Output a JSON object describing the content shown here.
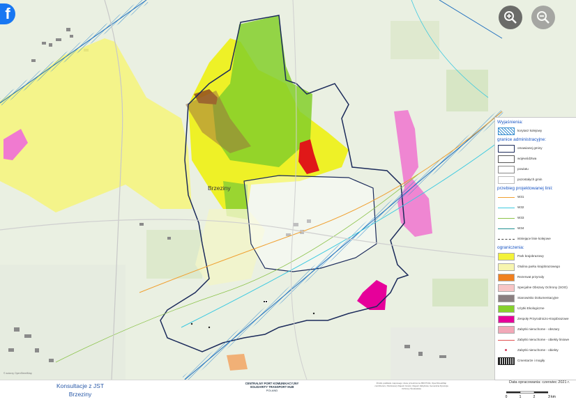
{
  "map": {
    "town_label": "Brzeziny",
    "attribution": "© autorzy OpenStreetMap"
  },
  "controls": {
    "facebook_glyph": "f",
    "zoom_in": "zoom-in",
    "zoom_out": "zoom-out"
  },
  "legend": {
    "heading": "Wyjaśnienia:",
    "items": [
      {
        "label": "korytarz kolejowy",
        "kind": "hatch",
        "color": "#3a8fd0"
      },
      {
        "label": "granice administracyjne:",
        "kind": "heading"
      },
      {
        "label": "omawianej gminy",
        "kind": "box",
        "color": "#1b2a5a"
      },
      {
        "label": "województwa",
        "kind": "box",
        "color": "#555555"
      },
      {
        "label": "powiatu",
        "kind": "box",
        "color": "#888888"
      },
      {
        "label": "pozostałych gmin",
        "kind": "box",
        "color": "#bbbbbb"
      },
      {
        "label": "przebieg projektowanej linii:",
        "kind": "heading"
      },
      {
        "label": "W31",
        "kind": "line",
        "color": "#f0a030"
      },
      {
        "label": "W32",
        "kind": "line",
        "color": "#3cc9e0"
      },
      {
        "label": "W33",
        "kind": "line",
        "color": "#8bc34a"
      },
      {
        "label": "W34",
        "kind": "line",
        "color": "#1f8f8f"
      },
      {
        "label": "istniejące linie kolejowe",
        "kind": "dash",
        "color": "#444444"
      },
      {
        "label": "ograniczenia:",
        "kind": "heading"
      },
      {
        "label": "Park krajobrazowy",
        "kind": "fill",
        "color": "#f3f23a"
      },
      {
        "label": "Otulina parku krajobrazowego",
        "kind": "fill",
        "color": "#f7f5b0"
      },
      {
        "label": "Rezerwat przyrody",
        "kind": "fill",
        "color": "#f08020"
      },
      {
        "label": "Specjalne Obszary Ochrony (SOO)",
        "kind": "fill",
        "color": "#f7c5c5"
      },
      {
        "label": "Stanowisko Dokumentacyjne",
        "kind": "fill",
        "color": "#8a7f80"
      },
      {
        "label": "Użytki Ekologiczne",
        "kind": "fill",
        "color": "#86d12c"
      },
      {
        "label": "Zespoły Przyrodniczo-Krajobrazowe",
        "kind": "fill",
        "color": "#e6009a"
      },
      {
        "label": "Zabytki nieruchome - obszary",
        "kind": "fill",
        "color": "#f2a8b8"
      },
      {
        "label": "Zabytki nieruchome - obiekty liniowe",
        "kind": "line",
        "color": "#e05050"
      },
      {
        "label": "Zabytki nieruchome - obiekty",
        "kind": "dot",
        "color": "#d04060"
      },
      {
        "label": "Cmentarze i mogiły",
        "kind": "grid",
        "color": "#222222"
      }
    ]
  },
  "footer": {
    "title_line1": "Konsultacje z JST",
    "title_line2": "Brzeziny",
    "cpk_line1": "CENTRALNY PORT KOMUNIKACYJNY",
    "cpk_line2": "SOLIDARITY TRANSPORT HUB",
    "cpk_line3": "POLAND",
    "fine_print": "Źródło podkładu mapowego: dane przestrzenne BDOT10k, OpenStreetMap contributors, Państwowy Rejestr Granic, Rejestr Zabytków, Generalna Dyrekcja Ochrony Środowiska",
    "date": "Data opracowania: czerwiec 2021 r.",
    "scale_labels": [
      "0",
      "1",
      "2",
      "3 km"
    ]
  }
}
